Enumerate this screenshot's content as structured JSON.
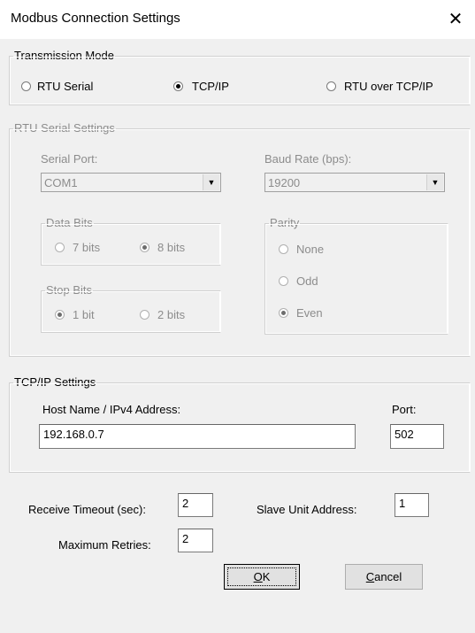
{
  "window": {
    "title": "Modbus Connection Settings",
    "close_glyph": "✕"
  },
  "transmission": {
    "legend": "Transmission Mode",
    "options": [
      "RTU Serial",
      "TCP/IP",
      "RTU over TCP/IP"
    ],
    "selected": "TCP/IP"
  },
  "rtu": {
    "legend": "RTU Serial Settings",
    "serial_port_label": "Serial Port:",
    "serial_port_value": "COM1",
    "baud_label": "Baud Rate (bps):",
    "baud_value": "19200",
    "data_bits": {
      "legend": "Data Bits",
      "options": [
        "7 bits",
        "8 bits"
      ],
      "selected": "8 bits"
    },
    "stop_bits": {
      "legend": "Stop Bits",
      "options": [
        "1 bit",
        "2 bits"
      ],
      "selected": "1 bit"
    },
    "parity": {
      "legend": "Parity",
      "options": [
        "None",
        "Odd",
        "Even"
      ],
      "selected": "Even"
    }
  },
  "tcp": {
    "legend": "TCP/IP Settings",
    "host_label": "Host Name / IPv4 Address:",
    "host_value": "192.168.0.7",
    "port_label": "Port:",
    "port_value": "502"
  },
  "misc": {
    "receive_timeout_label": "Receive Timeout (sec):",
    "receive_timeout_value": "2",
    "slave_label": "Slave Unit Address:",
    "slave_value": "1",
    "retries_label": "Maximum Retries:",
    "retries_value": "2"
  },
  "buttons": {
    "ok_mnemonic": "O",
    "ok_rest": "K",
    "cancel_mnemonic": "C",
    "cancel_rest": "ancel"
  },
  "icons": {
    "combo_arrow": "▼"
  }
}
